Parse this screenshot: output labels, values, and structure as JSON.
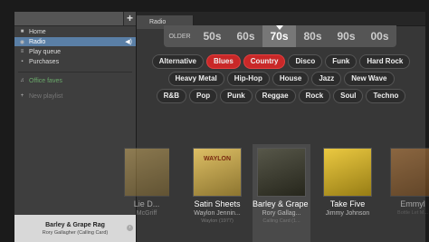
{
  "sidebar": {
    "add_label": "+",
    "items": [
      {
        "label": "Home",
        "icon": "home-icon",
        "glyph": "■"
      },
      {
        "label": "Radio",
        "icon": "radio-icon",
        "glyph": "◉",
        "selected": true
      },
      {
        "label": "Play queue",
        "icon": "queue-icon",
        "glyph": "≡"
      },
      {
        "label": "Purchases",
        "icon": "purchases-icon",
        "glyph": "▪"
      }
    ],
    "playlists": [
      {
        "label": "Office faves",
        "icon": "playlist-icon",
        "glyph": "♫"
      },
      {
        "label": "New playlist",
        "icon": "add-icon",
        "glyph": "+"
      }
    ],
    "volume_glyph": "◀)"
  },
  "now_playing": {
    "title": "Barley & Grape Rag",
    "subtitle": "Rory Gallagher (Calling Card)"
  },
  "tabs": [
    {
      "label": "Radio"
    }
  ],
  "decades": {
    "older_label": "OLDER",
    "items": [
      "50s",
      "60s",
      "70s",
      "80s",
      "90s",
      "00s"
    ],
    "selected": "70s"
  },
  "genres": [
    [
      {
        "label": "Alternative"
      },
      {
        "label": "Blues",
        "on": true
      },
      {
        "label": "Country",
        "on": true
      },
      {
        "label": "Disco"
      },
      {
        "label": "Funk"
      },
      {
        "label": "Hard Rock"
      }
    ],
    [
      {
        "label": "Heavy Metal"
      },
      {
        "label": "Hip-Hop"
      },
      {
        "label": "House"
      },
      {
        "label": "Jazz"
      },
      {
        "label": "New Wave"
      }
    ],
    [
      {
        "label": "R&B"
      },
      {
        "label": "Pop"
      },
      {
        "label": "Punk"
      },
      {
        "label": "Reggae"
      },
      {
        "label": "Rock"
      },
      {
        "label": "Soul"
      },
      {
        "label": "Techno"
      }
    ]
  ],
  "carousel": [
    {
      "title": "Lie D...",
      "artist": "McGriff",
      "album": "",
      "cover_bg": "#c9a24a"
    },
    {
      "title": "Satin Sheets",
      "artist": "Waylon Jennin...",
      "album": "Waylon (1977)",
      "cover_bg": "#d8b44a",
      "cover_text": "WAYLON"
    },
    {
      "title": "Barley & Grape Rag",
      "artist": "Rory Gallag...",
      "album": "Calling Card (1...",
      "cover_bg": "#3a3a2a",
      "selected": true
    },
    {
      "title": "Take Five",
      "artist": "Jimmy Johnson",
      "album": "",
      "cover_bg": "#e8c020"
    },
    {
      "title": "Emmyl",
      "artist": "",
      "album": "Bottle Let M...",
      "cover_bg": "#c87a2a"
    }
  ]
}
